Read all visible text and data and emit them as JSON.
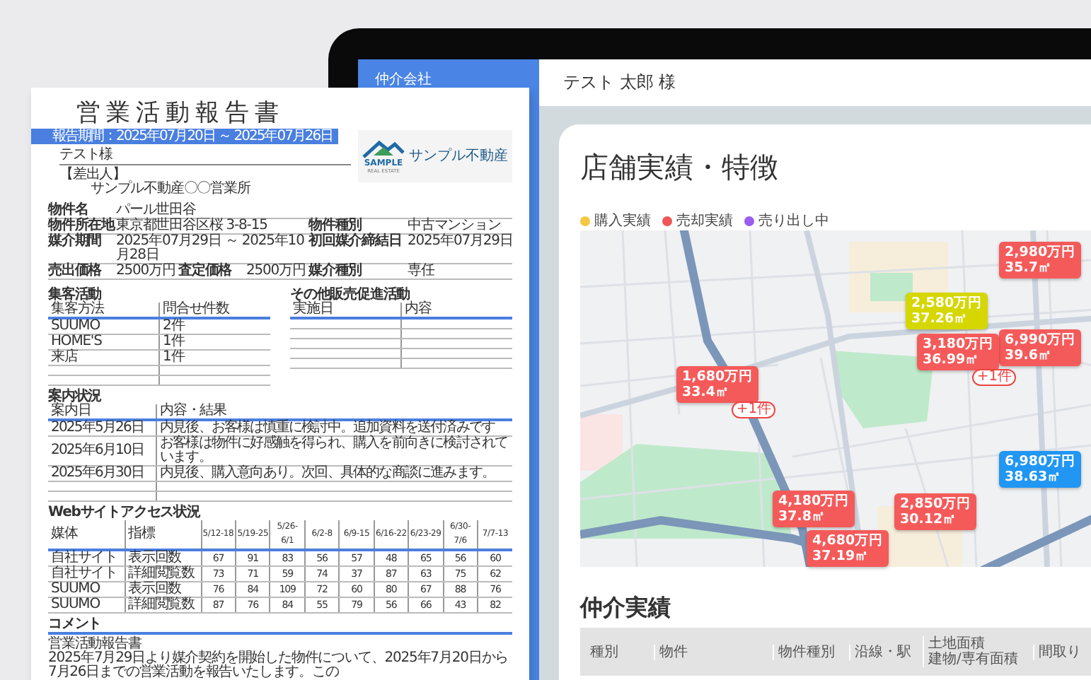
{
  "document": {
    "title": "営業活動報告書",
    "period": "報告期間：2025年07月20日 ～ 2025年07月26日",
    "recipient": "テスト様",
    "sender_label": "【差出人】",
    "sender": "サンプル不動産〇〇営業所",
    "logo": {
      "mark_text": "SAMPLE",
      "mark_subtext": "REAL ESTATE",
      "name": "サンプル不動産"
    },
    "property": [
      [
        {
          "label": "物件名",
          "value": "パール世田谷"
        }
      ],
      [
        {
          "label": "物件所在地",
          "value": "東京都世田谷区桜 3-8-15"
        },
        {
          "label": "物件種別",
          "value": "中古マンション"
        }
      ],
      [
        {
          "label": "媒介期間",
          "value": "2025年07月29日 ～ 2025年10月28日"
        },
        {
          "label": "初回媒介締結日",
          "value": "2025年07月29日"
        }
      ],
      [
        {
          "label": "売出価格",
          "value": "2500万円"
        },
        {
          "label": "査定価格",
          "value": "2500万円"
        },
        {
          "label": "媒介種別",
          "value": "専任"
        }
      ]
    ],
    "campaign": {
      "title": "集客活動",
      "columns": [
        "集客方法",
        "問合せ件数"
      ],
      "rows": [
        [
          "SUUMO",
          "2件"
        ],
        [
          "HOME'S",
          "1件"
        ],
        [
          "来店",
          "1件"
        ]
      ]
    },
    "other_promotion": {
      "title": "その他販売促進活動",
      "columns": [
        "実施日",
        "内容"
      ]
    },
    "showings": {
      "title": "案内状況",
      "columns": [
        "案内日",
        "内容・結果"
      ],
      "rows": [
        [
          "2025年5月26日",
          "内見後、お客様は慎重に検討中。追加資料を送付済みです"
        ],
        [
          "2025年6月10日",
          "お客様は物件に好感触を得られ、購入を前向きに検討されています。"
        ],
        [
          "2025年6月30日",
          "内見後、購入意向あり。次回、具体的な商談に進みます。"
        ]
      ]
    },
    "web_access": {
      "title": "Webサイトアクセス状況",
      "columns": [
        "媒体",
        "指標",
        "5/12-18",
        "5/19-25",
        "5/26-6/1",
        "6/2-8",
        "6/9-15",
        "6/16-22",
        "6/23-29",
        "6/30-7/6",
        "7/7-13"
      ],
      "rows": [
        [
          "自社サイト",
          "表示回数",
          "67",
          "91",
          "83",
          "56",
          "57",
          "48",
          "65",
          "56",
          "60"
        ],
        [
          "自社サイト",
          "詳細閲覧数",
          "73",
          "71",
          "59",
          "74",
          "37",
          "87",
          "63",
          "75",
          "62"
        ],
        [
          "SUUMO",
          "表示回数",
          "76",
          "84",
          "109",
          "72",
          "60",
          "80",
          "67",
          "88",
          "76"
        ],
        [
          "SUUMO",
          "詳細閲覧数",
          "87",
          "76",
          "84",
          "55",
          "79",
          "56",
          "66",
          "43",
          "82"
        ]
      ]
    },
    "comment": {
      "title": "コメント",
      "subtitle": "営業活動報告書",
      "text": "2025年7月29日より媒介契約を開始した物件について、2025年7月20日から7月26日までの営業活動を報告いたします。この"
    }
  },
  "app": {
    "sidebar": {
      "label": "仲介会社"
    },
    "header": {
      "user": "テスト 太郎 様"
    },
    "store": {
      "title": "店舗実績・特徴",
      "legend": [
        {
          "label": "購入実績",
          "color": "#f5c842"
        },
        {
          "label": "売却実績",
          "color": "#f05656"
        },
        {
          "label": "売り出し中",
          "color": "#9b5cf0"
        }
      ],
      "markers": [
        {
          "price": "2,980万円",
          "area": "35.7㎡",
          "color": "#f55a5a"
        },
        {
          "price": "2,580万円",
          "area": "37.26㎡",
          "color": "#d6d600"
        },
        {
          "price": "6,990万円",
          "area": "39.6㎡",
          "color": "#f55a5a"
        },
        {
          "price": "3,180万円",
          "area": "36.99㎡",
          "color": "#f55a5a",
          "badge": "+1件"
        },
        {
          "price": "1,680万円",
          "area": "33.4㎡",
          "color": "#f55a5a",
          "badge": "+1件"
        },
        {
          "price": "6,980万円",
          "area": "38.63㎡",
          "color": "#2196f3"
        },
        {
          "price": "4,180万円",
          "area": "37.8㎡",
          "color": "#f55a5a"
        },
        {
          "price": "2,850万円",
          "area": "30.12㎡",
          "color": "#f55a5a"
        },
        {
          "price": "4,680万円",
          "area": "37.19㎡",
          "color": "#f55a5a"
        }
      ]
    },
    "brokerage": {
      "title": "仲介実績",
      "columns": [
        [
          "種別"
        ],
        [
          "物件"
        ],
        [
          "物件種別"
        ],
        [
          "沿線・駅"
        ],
        [
          "土地面積",
          "建物/専有面積"
        ],
        [
          "間取り"
        ]
      ]
    }
  }
}
